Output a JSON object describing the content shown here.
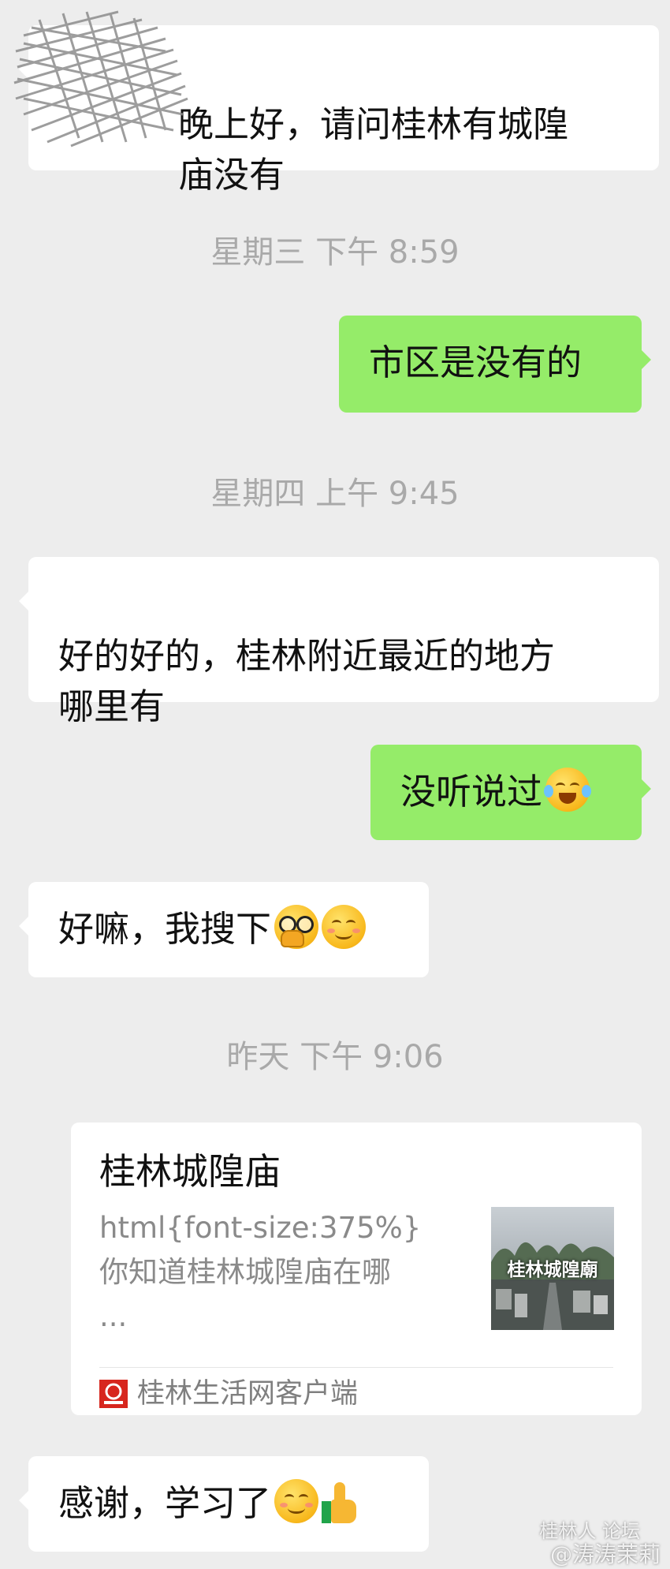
{
  "messages": [
    {
      "side": "in",
      "text": "晚上好，请问桂林有城隍\n庙没有"
    },
    {
      "side": "out",
      "text": "市区是没有的"
    },
    {
      "side": "in",
      "text": "好的好的，桂林附近最近的地方\n哪里有"
    },
    {
      "side": "out",
      "text": "没听说过",
      "emoji": "tears-of-joy-emoji"
    },
    {
      "side": "in",
      "text": "好嘛，我搜下",
      "emoji": [
        "thinking-glasses-emoji",
        "smile-emoji"
      ]
    },
    {
      "side": "in",
      "text": "感谢，学习了",
      "emoji": [
        "smile-emoji",
        "thumbs-up-emoji"
      ]
    }
  ],
  "timestamps": [
    "星期三 下午 8:59",
    "星期四 上午 9:45",
    "昨天 下午 9:06"
  ],
  "link_card": {
    "title": "桂林城隍庙",
    "description": "html{font-size:375%}\n你知道桂林城隍庙在哪\n...",
    "thumbnail_text": "桂林城隍廟",
    "source": "桂林生活网客户端"
  },
  "watermark": {
    "line1": "桂林人 论坛",
    "line2": "@涛涛茉莉"
  },
  "colors": {
    "background": "#ededed",
    "incoming": "#ffffff",
    "outgoing": "#95ec69",
    "timestamp": "#a9a9a9"
  }
}
